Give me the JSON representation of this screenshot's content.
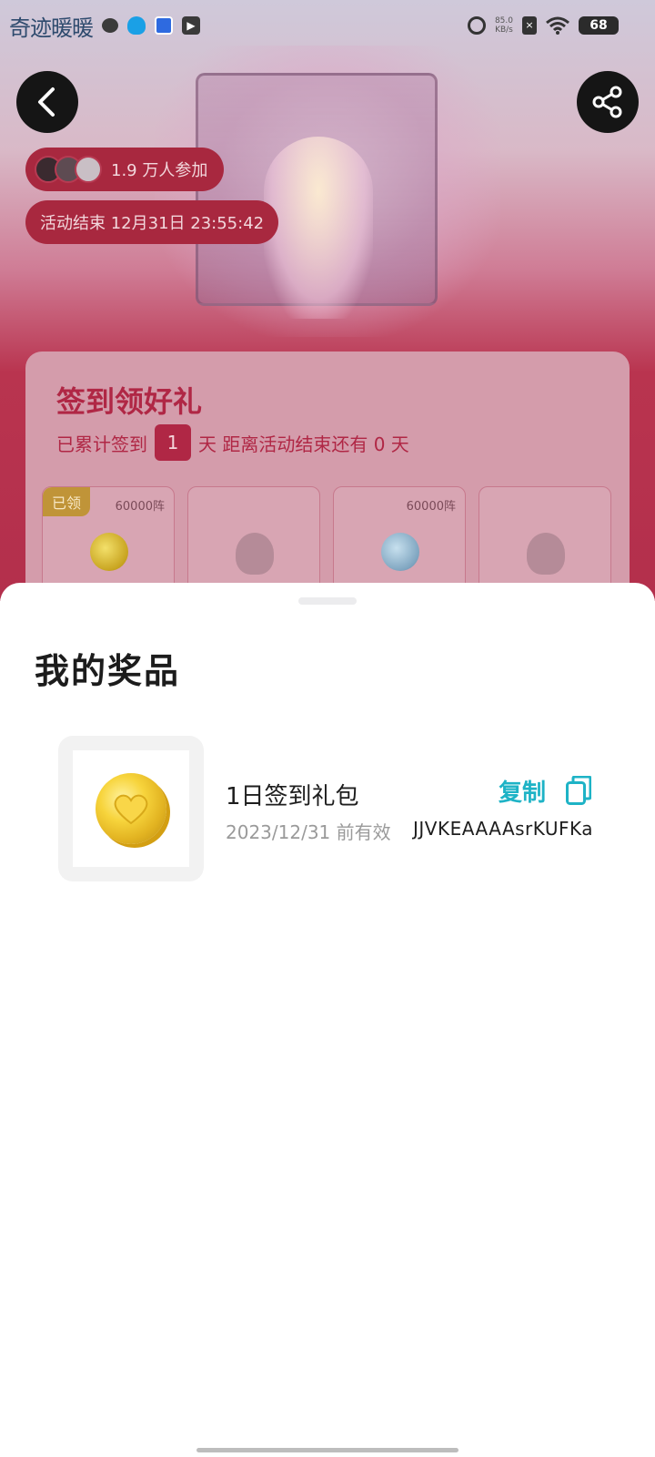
{
  "status_bar": {
    "app_logo": "奇迹暖暖",
    "net_speed_value": "85.0",
    "net_speed_unit": "KB/s",
    "battery": "68",
    "icons": [
      "wechat-icon",
      "qq-icon",
      "baidu-icon",
      "video-icon",
      "alarm-icon",
      "sim-icon",
      "wifi-icon",
      "battery-icon"
    ]
  },
  "header": {
    "back_icon": "chevron-left-icon",
    "share_icon": "share-icon"
  },
  "event": {
    "participants": "1.9 万人参加",
    "end_time": "活动结束 12月31日 23:55:42"
  },
  "checkin_card": {
    "title": "签到领好礼",
    "progress_prefix": "已累计签到",
    "days_signed": "1",
    "progress_middle": "天  距离活动结束还有 0 天",
    "rewards": [
      {
        "tag": "已领",
        "count": "60000阵",
        "icon": "gold-coin-icon"
      },
      {
        "tag": "",
        "count": "",
        "icon": "locked-reward-icon"
      },
      {
        "tag": "",
        "count": "60000阵",
        "icon": "blue-coin-icon"
      },
      {
        "tag": "",
        "count": "",
        "icon": "locked-reward-icon"
      }
    ]
  },
  "sheet": {
    "title": "我的奖品",
    "prize": {
      "name": "1日签到礼包",
      "expiry": "2023/12/31 前有效",
      "copy_label": "复制",
      "code": "JJVKEAAAAsrKUFKa",
      "icon": "gold-heart-coin-icon"
    }
  },
  "colors": {
    "accent_red": "#b02745",
    "copy_teal": "#1eb3c6"
  }
}
